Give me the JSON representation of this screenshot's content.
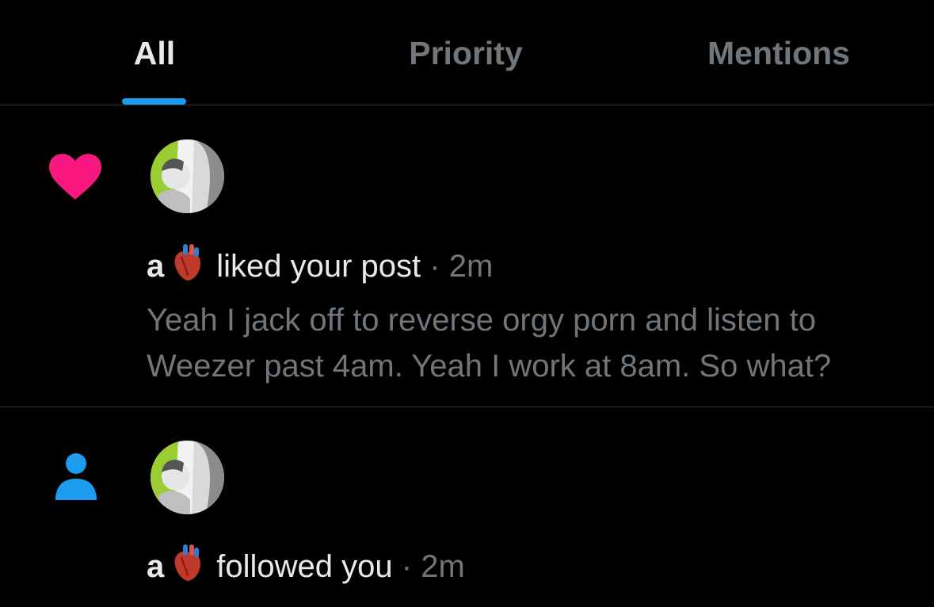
{
  "tabs": [
    {
      "label": "All",
      "active": true
    },
    {
      "label": "Priority",
      "active": false
    },
    {
      "label": "Mentions",
      "active": false
    }
  ],
  "notifications": [
    {
      "type_icon": "heart-icon",
      "type_color": "#f91880",
      "username": "a",
      "username_emoji": "anatomical-heart-emoji",
      "action": "liked your post",
      "separator": "·",
      "time": "2m",
      "post_text": "Yeah I jack off to reverse orgy porn and listen to Weezer past 4am. Yeah I work at 8am. So what?"
    },
    {
      "type_icon": "person-icon",
      "type_color": "#1d9bf0",
      "username": "a",
      "username_emoji": "anatomical-heart-emoji",
      "action": "followed you",
      "separator": "·",
      "time": "2m"
    }
  ],
  "colors": {
    "background": "#000000",
    "primary_text": "#e7e9ea",
    "secondary_text": "#71767b",
    "accent": "#1d9bf0",
    "divider": "#2f3336"
  }
}
